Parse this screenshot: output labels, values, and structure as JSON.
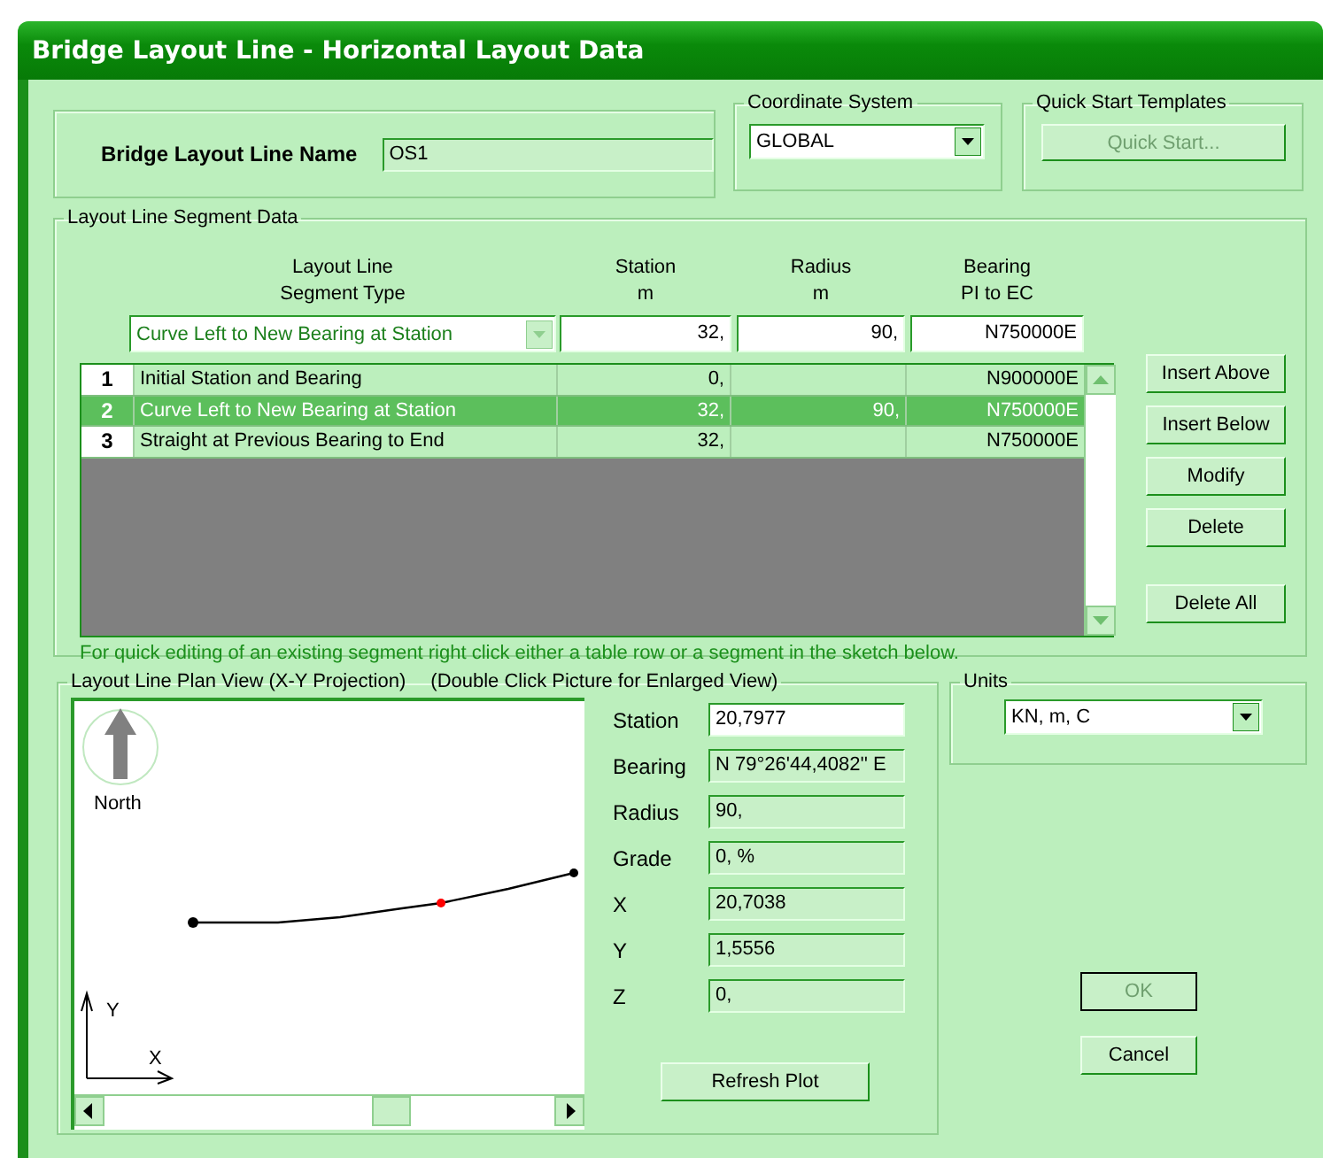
{
  "window": {
    "title": "Bridge Layout Line - Horizontal Layout Data"
  },
  "name_group": {
    "label": "Bridge Layout Line Name",
    "value": "OS1"
  },
  "coordinate_system": {
    "legend": "Coordinate System",
    "value": "GLOBAL"
  },
  "quick_start": {
    "legend": "Quick Start Templates",
    "button": "Quick Start...",
    "disabled": true
  },
  "segment_data": {
    "legend": "Layout Line Segment Data",
    "columns": [
      {
        "lines": [
          "Layout Line",
          "Segment Type"
        ]
      },
      {
        "lines": [
          "Station",
          "m"
        ]
      },
      {
        "lines": [
          "Radius",
          "m"
        ]
      },
      {
        "lines": [
          "Bearing",
          "PI to EC"
        ]
      }
    ],
    "editor": {
      "type": "Curve Left to New Bearing at Station",
      "station": "32,",
      "radius": "90,",
      "bearing": "N750000E"
    },
    "rows": [
      {
        "number": "1",
        "type": "Initial Station and Bearing",
        "station": "0,",
        "bearing": "N900000E",
        "selected": false
      },
      {
        "number": "2",
        "type": "Curve Left to New Bearing at Station",
        "station": "32,",
        "radius": "90,",
        "bearing": "N750000E",
        "selected": true
      },
      {
        "number": "3",
        "type": "Straight at Previous Bearing to End",
        "station": "32,",
        "bearing": "N750000E",
        "selected": false
      }
    ],
    "buttons": [
      "Insert Above",
      "Insert Below",
      "Modify",
      "Delete",
      "Delete All"
    ],
    "hint": "For quick editing of an existing segment right click either a table row or a segment in the sketch below."
  },
  "plan_view": {
    "legend": "Layout Line Plan View (X-Y Projection)",
    "legend_note": "(Double Click Picture for Enlarged View)",
    "north_label": "North",
    "y_label": "Y",
    "x_label": "X",
    "fields": [
      {
        "label": "Station",
        "value": "20,7977",
        "editable": true
      },
      {
        "label": "Bearing",
        "value": "N 79°26'44,4082'' E",
        "editable": false
      },
      {
        "label": "Radius",
        "value": "90,",
        "editable": false
      },
      {
        "label": "Grade",
        "value": "0, %",
        "editable": false
      },
      {
        "label": "X",
        "value": "20,7038",
        "editable": false
      },
      {
        "label": "Y",
        "value": "1,5556",
        "editable": false
      },
      {
        "label": "Z",
        "value": "0,",
        "editable": false
      }
    ],
    "refresh_button": "Refresh Plot"
  },
  "units": {
    "legend": "Units",
    "value": "KN, m, C"
  },
  "ok": {
    "label": "OK",
    "disabled": true
  },
  "cancel": {
    "label": "Cancel"
  }
}
